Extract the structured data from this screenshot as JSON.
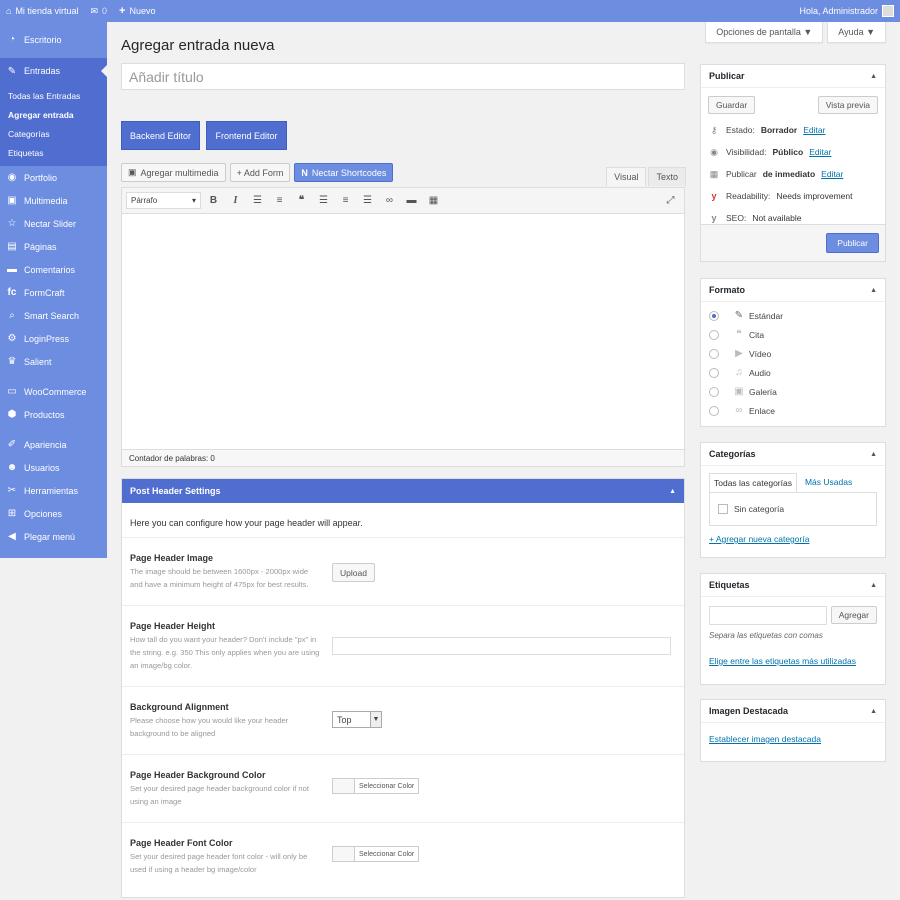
{
  "adminbar": {
    "site_name": "Mi tienda virtual",
    "comments_count": "0",
    "new_label": "Nuevo",
    "greeting": "Hola, Administrador"
  },
  "sidebar": {
    "items": [
      {
        "label": "Escritorio",
        "icon": "dashboard-icon"
      },
      {
        "label": "Entradas",
        "icon": "pin-icon"
      },
      {
        "label": "Portfolio",
        "icon": "portfolio-icon"
      },
      {
        "label": "Multimedia",
        "icon": "media-icon"
      },
      {
        "label": "Nectar Slider",
        "icon": "star-icon"
      },
      {
        "label": "Páginas",
        "icon": "pages-icon"
      },
      {
        "label": "Comentarios",
        "icon": "comments-icon"
      },
      {
        "label": "FormCraft",
        "icon": "formcraft-icon"
      },
      {
        "label": "Smart Search",
        "icon": "search-icon"
      },
      {
        "label": "LoginPress",
        "icon": "gear-icon"
      },
      {
        "label": "Salient",
        "icon": "salient-icon"
      },
      {
        "label": "WooCommerce",
        "icon": "woo-icon"
      },
      {
        "label": "Productos",
        "icon": "box-icon"
      },
      {
        "label": "Apariencia",
        "icon": "brush-icon"
      },
      {
        "label": "Usuarios",
        "icon": "users-icon"
      },
      {
        "label": "Herramientas",
        "icon": "wrench-icon"
      },
      {
        "label": "Opciones",
        "icon": "settings-icon"
      },
      {
        "label": "Plegar menú",
        "icon": "collapse-icon"
      }
    ],
    "submenu": [
      "Todas las Entradas",
      "Agregar entrada",
      "Categorías",
      "Etiquetas"
    ]
  },
  "screen": {
    "options_label": "Opciones de pantalla ▼",
    "help_label": "Ayuda ▼"
  },
  "page": {
    "title": "Agregar entrada nueva",
    "title_placeholder": "Añadir título"
  },
  "builder": {
    "backend": "Backend Editor",
    "frontend": "Frontend Editor"
  },
  "media": {
    "add_media": "Agregar multimedia",
    "add_form": "+ Add Form",
    "nectar": "Nectar Shortcodes"
  },
  "editor": {
    "tab_visual": "Visual",
    "tab_text": "Texto",
    "format": "Párrafo",
    "wordcount": "Contador de palabras: 0"
  },
  "phs": {
    "title": "Post Header Settings",
    "intro": "Here you can configure how your page header will appear.",
    "rows": [
      {
        "label": "Page Header Image",
        "desc": "The image should be between 1600px - 2000px wide and have a minimum height of 475px for best results.",
        "control": "Upload"
      },
      {
        "label": "Page Header Height",
        "desc": "How tall do you want your header? Don't include \"px\" in the string. e.g. 350 This only applies when you are using an image/bg color.",
        "control": ""
      },
      {
        "label": "Background Alignment",
        "desc": "Please choose how you would like your header background to be aligned",
        "control": "Top"
      },
      {
        "label": "Page Header Background Color",
        "desc": "Set your desired page header background color if not using an image",
        "control": "Seleccionar Color"
      },
      {
        "label": "Page Header Font Color",
        "desc": "Set your desired page header font color - will only be used if using a header bg image/color",
        "control": "Seleccionar Color"
      }
    ]
  },
  "publish": {
    "title": "Publicar",
    "save": "Guardar",
    "preview": "Vista previa",
    "status_label": "Estado:",
    "status_value": "Borrador",
    "visibility_label": "Visibilidad:",
    "visibility_value": "Público",
    "schedule_label": "Publicar",
    "schedule_value": "de inmediato",
    "readability_label": "Readability:",
    "readability_value": "Needs improvement",
    "seo_label": "SEO:",
    "seo_value": "Not available",
    "edit": "Editar",
    "publish_btn": "Publicar"
  },
  "format": {
    "title": "Formato",
    "options": [
      {
        "label": "Estándar",
        "icon": "pin-icon",
        "checked": true
      },
      {
        "label": "Cita",
        "icon": "quote-icon",
        "checked": false
      },
      {
        "label": "Vídeo",
        "icon": "video-icon",
        "checked": false
      },
      {
        "label": "Audio",
        "icon": "audio-icon",
        "checked": false
      },
      {
        "label": "Galería",
        "icon": "gallery-icon",
        "checked": false
      },
      {
        "label": "Enlace",
        "icon": "link-icon",
        "checked": false
      }
    ]
  },
  "categories": {
    "title": "Categorías",
    "tab_all": "Todas las categorías",
    "tab_used": "Más Usadas",
    "item": "Sin categoría",
    "add_link": "+ Agregar nueva categoría"
  },
  "tags": {
    "title": "Etiquetas",
    "add_btn": "Agregar",
    "hint": "Separa las etiquetas con comas",
    "choose_link": "Elige entre las etiquetas más utilizadas"
  },
  "featured": {
    "title": "Imagen Destacada",
    "set_link": "Establecer imagen destacada"
  },
  "colors": {
    "accent": "#6d8de0",
    "accent_dark": "#4f6ed0",
    "link": "#0073aa"
  }
}
